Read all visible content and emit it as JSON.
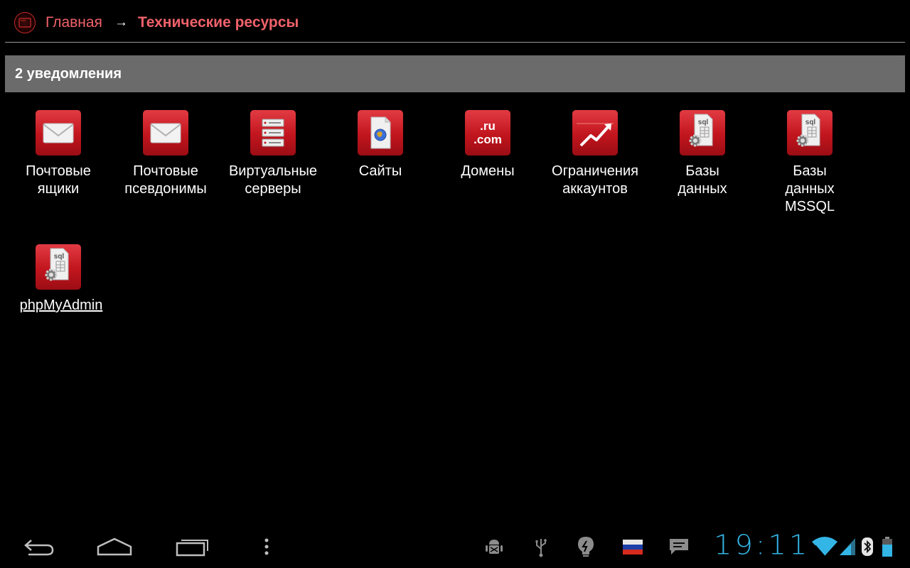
{
  "breadcrumb": {
    "home_label": "Главная",
    "separator": "→",
    "current_label": "Технические ресурсы"
  },
  "notifications": {
    "text": "2 уведомления"
  },
  "tiles": [
    {
      "label": "Почтовые\nящики",
      "icon": "mail-envelope-icon"
    },
    {
      "label": "Почтовые\nпсевдонимы",
      "icon": "mail-envelope-icon"
    },
    {
      "label": "Виртуальные\nсерверы",
      "icon": "server-rack-icon"
    },
    {
      "label": "Сайты",
      "icon": "website-globe-icon"
    },
    {
      "label": "Домены",
      "icon": "domain-icon",
      "icon_text": [
        ".ru",
        ".com"
      ]
    },
    {
      "label": "Ограничения\nаккаунтов",
      "icon": "trend-chart-icon"
    },
    {
      "label": "Базы\nданных",
      "icon": "sql-database-icon",
      "icon_text": "sql"
    },
    {
      "label": "Базы\nданных\nMSSQL",
      "icon": "sql-database-icon",
      "icon_text": "sql"
    },
    {
      "label": "phpMyAdmin",
      "icon": "sql-database-icon",
      "icon_text": "sql"
    }
  ],
  "system_bar": {
    "clock": "19:11",
    "nav_icons": [
      "back-icon",
      "home-icon",
      "recent-apps-icon",
      "menu-overflow-icon"
    ],
    "status_icons": [
      "android-debug-icon",
      "usb-icon",
      "lightbulb-icon",
      "russian-flag-icon",
      "message-icon",
      "wifi-icon",
      "signal-icon",
      "bluetooth-icon",
      "battery-icon"
    ]
  },
  "colors": {
    "accent_red": "#f0626a",
    "tile_red": "#c2151e",
    "notification_bar": "#6b6b6b",
    "clock_blue": "#33b5e5"
  }
}
